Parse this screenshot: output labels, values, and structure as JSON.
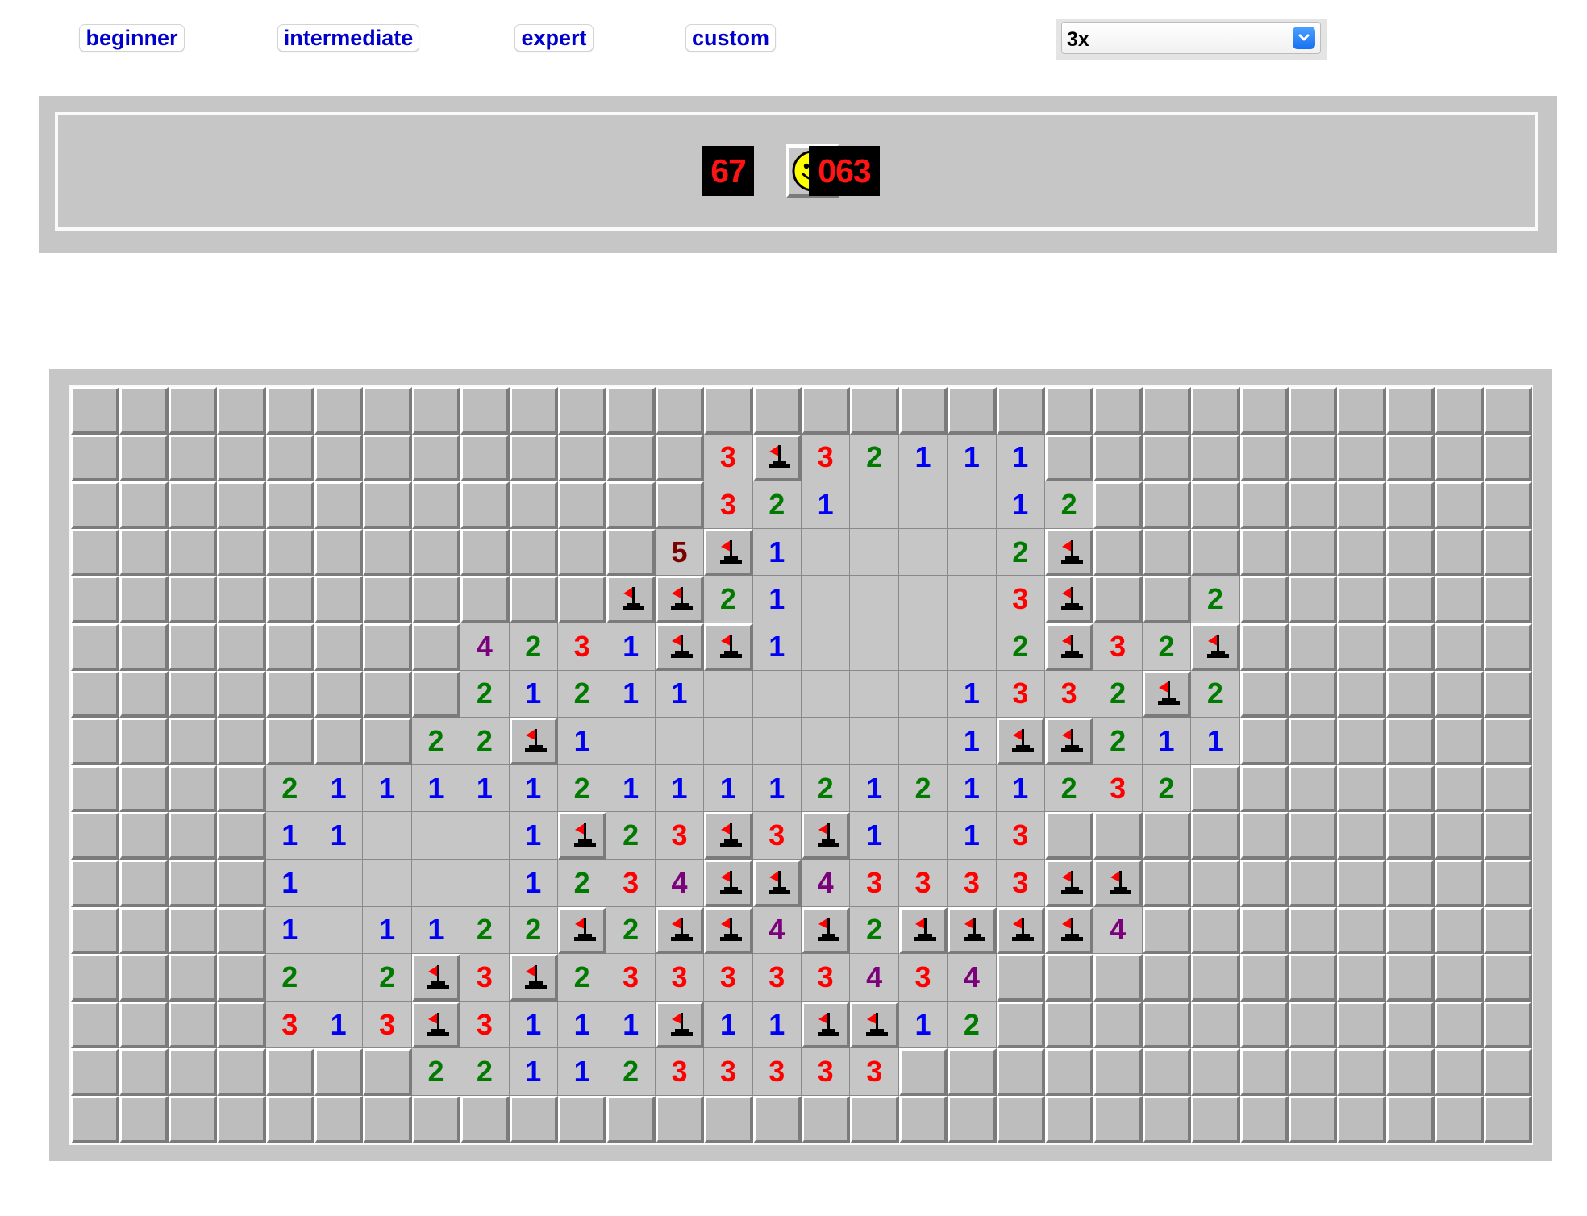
{
  "levels": {
    "beginner": "beginner",
    "intermediate": "intermediate",
    "expert": "expert",
    "custom": "custom"
  },
  "zoom": {
    "selected": "3x"
  },
  "counter": {
    "mines_left": "67",
    "timer": "063",
    "face": "smile-face-icon"
  },
  "number_colors": {
    "1": "#0000f4",
    "2": "#007b00",
    "3": "#ff0000",
    "4": "#7b007b",
    "5": "#7b0000"
  },
  "board": {
    "legend": "# = covered, . = empty revealed, F = flag, digit = mine count",
    "rows": [
      "##############################",
      "#############3F32111##########",
      "#############321...12#########",
      "############5F1....2F#########",
      "###########FF21....3F##2######",
      "########4231FF1....2F32F######",
      "########21211.....1332F2######",
      "#######22F1.......1FF211######",
      "####2111112111121211232#######",
      "####11...1F23F3F1.13##########",
      "####1....1234FF43333FF########",
      "####1.1122F2FF4F2FFFF4########",
      "####2.2F3F233333434###########",
      "####313F3111F11FF12###########",
      "#######2211233333#############",
      "##############################"
    ]
  }
}
